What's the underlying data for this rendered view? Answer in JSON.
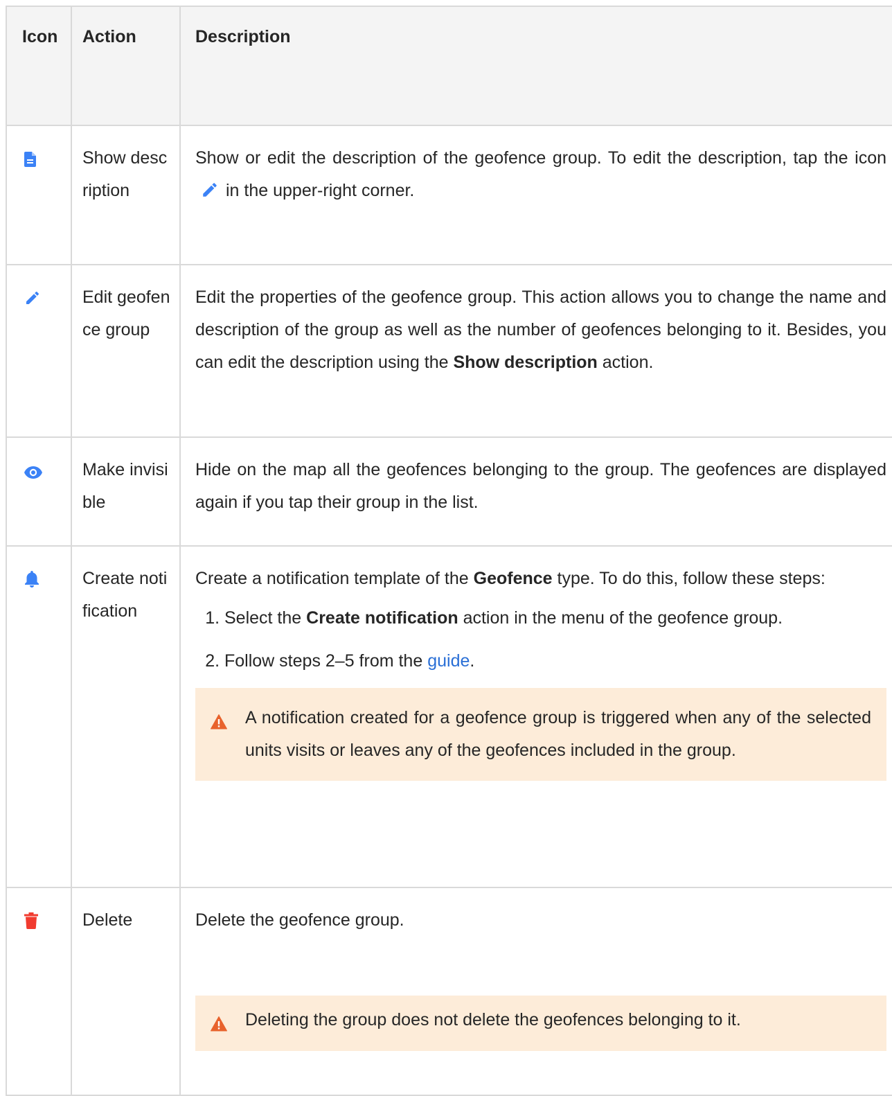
{
  "header": {
    "icon": "Icon",
    "action": "Action",
    "description": "Description"
  },
  "rows": [
    {
      "icon": "document-icon",
      "action": "Show description",
      "desc_a": "Show or edit the description of the geofence group. To edit the description, tap the icon",
      "desc_b": "in the upper-right corner."
    },
    {
      "icon": "pencil-icon",
      "action": "Edit geofence group",
      "desc_a": "Edit the properties of the geofence group. This action allows you to change the name and description of the group as well as the number of geofences belonging to it. Besides, you can edit the description using the",
      "desc_bold": "Show description",
      "desc_b": "action."
    },
    {
      "icon": "eye-icon",
      "action": "Make invisible",
      "desc_a": "Hide on the map all the geofences belonging to the group. The geofences are displayed again if you tap their group in the list."
    },
    {
      "icon": "bell-icon",
      "action": "Create notification",
      "desc_a": "Create a notification template of the",
      "desc_bold": "Geofence",
      "desc_b": "type. To do this, follow these steps:",
      "steps": [
        {
          "pre": "Select the",
          "bold": "Create notification",
          "post": "action in the menu of the geofence group."
        },
        {
          "pre": "Follow steps 2–5 from the",
          "link": "guide",
          "post": "."
        }
      ],
      "note": "A notification created for a geofence group is triggered when any of the selected units visits or leaves any of the geofences included in the group."
    },
    {
      "icon": "trash-icon",
      "action": "Delete",
      "desc_a": "Delete the geofence group.",
      "note": "Deleting the group does not delete the geofences belonging to it."
    }
  ],
  "colors": {
    "accent": "#3b82f6",
    "danger": "#f13b2f",
    "warning_icon": "#e8622c",
    "note_bg": "#fdecd9",
    "header_bg": "#f4f4f4",
    "border": "#d9d9d9",
    "link": "#2a6fd6"
  }
}
